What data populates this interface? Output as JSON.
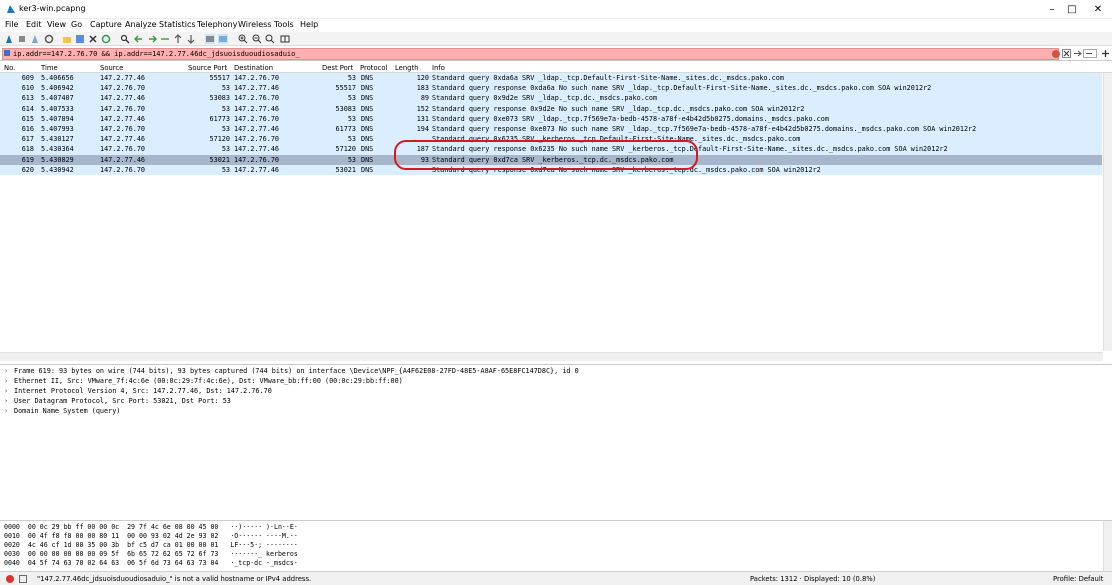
{
  "window": {
    "title": "ker3-win.pcapng"
  },
  "menu": [
    "File",
    "Edit",
    "View",
    "Go",
    "Capture",
    "Analyze",
    "Statistics",
    "Telephony",
    "Wireless",
    "Tools",
    "Help"
  ],
  "filter": {
    "value": "ip.addr==147.2.76.70 && ip.addr==147.2.77.46dc_jdsuoisduoudiosaduio_"
  },
  "columns": [
    "No.",
    "Time",
    "Source",
    "Source Port",
    "Destination",
    "Dest Port",
    "Protocol",
    "Length",
    "Info"
  ],
  "packets": [
    {
      "no": "609",
      "time": "5.406656",
      "src": "147.2.77.46",
      "sport": "55517",
      "dst": "147.2.76.70",
      "dport": "53",
      "proto": "DNS",
      "len": "120",
      "info": "Standard query 0xda6a SRV _ldap._tcp.Default-First-Site-Name._sites.dc._msdcs.pako.com"
    },
    {
      "no": "610",
      "time": "5.406942",
      "src": "147.2.76.70",
      "sport": "53",
      "dst": "147.2.77.46",
      "dport": "55517",
      "proto": "DNS",
      "len": "183",
      "info": "Standard query response 0xda6a No such name SRV _ldap._tcp.Default-First-Site-Name._sites.dc._msdcs.pako.com SOA win2012r2"
    },
    {
      "no": "613",
      "time": "5.407407",
      "src": "147.2.77.46",
      "sport": "53083",
      "dst": "147.2.76.70",
      "dport": "53",
      "proto": "DNS",
      "len": "89",
      "info": "Standard query 0x9d2e SRV _ldap._tcp.dc._msdcs.pako.com"
    },
    {
      "no": "614",
      "time": "5.407533",
      "src": "147.2.76.70",
      "sport": "53",
      "dst": "147.2.77.46",
      "dport": "53083",
      "proto": "DNS",
      "len": "152",
      "info": "Standard query response 0x9d2e No such name SRV _ldap._tcp.dc._msdcs.pako.com SOA win2012r2"
    },
    {
      "no": "615",
      "time": "5.407894",
      "src": "147.2.77.46",
      "sport": "61773",
      "dst": "147.2.76.70",
      "dport": "53",
      "proto": "DNS",
      "len": "131",
      "info": "Standard query 0xe073 SRV _ldap._tcp.7f569e7a-bedb-4578-a78f-e4b42d5b0275.domains._msdcs.pako.com"
    },
    {
      "no": "616",
      "time": "5.407993",
      "src": "147.2.76.70",
      "sport": "53",
      "dst": "147.2.77.46",
      "dport": "61773",
      "proto": "DNS",
      "len": "194",
      "info": "Standard query response 0xe073 No such name SRV _ldap._tcp.7f569e7a-bedb-4578-a78f-e4b42d5b0275.domains._msdcs.pako.com SOA win2012r2"
    },
    {
      "no": "617",
      "time": "5.430127",
      "src": "147.2.77.46",
      "sport": "57120",
      "dst": "147.2.76.70",
      "dport": "53",
      "proto": "DNS",
      "len": "",
      "info": "Standard query 0x6235 SRV _kerberos._tcp.Default-First-Site-Name._sites.dc._msdcs.pako.com"
    },
    {
      "no": "618",
      "time": "5.430364",
      "src": "147.2.76.70",
      "sport": "53",
      "dst": "147.2.77.46",
      "dport": "57120",
      "proto": "DNS",
      "len": "187",
      "info": "Standard query response 0x6235 No such name SRV _kerberos._tcp.Default-First-Site-Name._sites.dc._msdcs.pako.com SOA win2012r2"
    },
    {
      "no": "619",
      "time": "5.430829",
      "src": "147.2.77.46",
      "sport": "53021",
      "dst": "147.2.76.70",
      "dport": "53",
      "proto": "DNS",
      "len": "93",
      "info": "Standard query 0xd7ca SRV _kerberos._tcp.dc._msdcs.pako.com"
    },
    {
      "no": "620",
      "time": "5.430942",
      "src": "147.2.76.70",
      "sport": "53",
      "dst": "147.2.77.46",
      "dport": "53021",
      "proto": "DNS",
      "len": "",
      "info": "Standard query response 0xd7ca No such name SRV _kerberos._tcp.dc._msdcs.pako.com SOA win2012r2"
    }
  ],
  "details": [
    "Frame 619: 93 bytes on wire (744 bits), 93 bytes captured (744 bits) on interface \\Device\\NPF_{A4F62E08-27FD-48E5-A8AF-65E8FC147D8C}, id 0",
    "Ethernet II, Src: VMware_7f:4c:6e (00:0c:29:7f:4c:6e), Dst: VMware_bb:ff:00 (00:0c:29:bb:ff:00)",
    "Internet Protocol Version 4, Src: 147.2.77.46, Dst: 147.2.76.70",
    "User Datagram Protocol, Src Port: 53021, Dst Port: 53",
    "Domain Name System (query)"
  ],
  "bytes": [
    {
      "off": "0000",
      "hex": "00 0c 29 bb ff 00 00 0c  29 7f 4c 6e 08 00 45 00",
      "ascii": "··)····· )·Ln··E·"
    },
    {
      "off": "0010",
      "hex": "00 4f f8 f8 00 00 80 11  00 00 93 02 4d 2e 93 02",
      "ascii": "·O······ ····M.··"
    },
    {
      "off": "0020",
      "hex": "4c 46 cf 1d 00 35 00 3b  bf c5 d7 ca 01 00 00 01",
      "ascii": "LF···5·; ········"
    },
    {
      "off": "0030",
      "hex": "00 00 00 00 00 00 09 5f  6b 65 72 62 65 72 6f 73",
      "ascii": "·······_ kerberos"
    },
    {
      "off": "0040",
      "hex": "04 5f 74 63 70 02 64 63  06 5f 6d 73 64 63 73 04",
      "ascii": "·_tcp·dc ·_msdcs·"
    }
  ],
  "status": {
    "message": "\"147.2.77.46dc_jdsuoisduoudiosaduio_\" is not a valid hostname or IPv4 address.",
    "packets": "Packets: 1312 · Displayed: 10 (0.8%)",
    "profile": "Profile: Default"
  },
  "colors": {
    "udp_row": "#daeeff",
    "selected_row": "#a8b6cc",
    "filter_invalid": "#ffafaf",
    "annotation": "#d41a1a"
  }
}
